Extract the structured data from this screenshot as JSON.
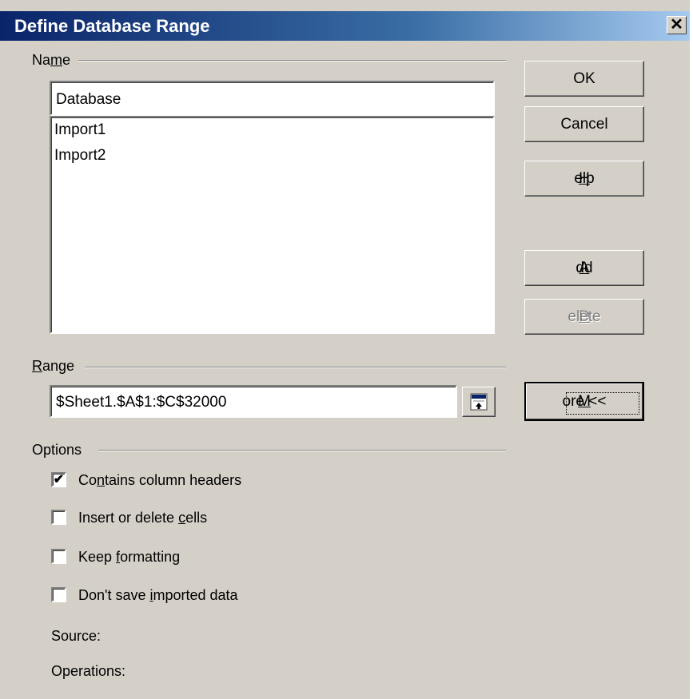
{
  "window": {
    "title": "Define Database Range",
    "close_glyph": "✕"
  },
  "name_section": {
    "label_pre": "Na",
    "label_key": "m",
    "label_post": "e",
    "input_value": "Database",
    "list_items": [
      "Import1",
      "Import2"
    ]
  },
  "range_section": {
    "label_key": "R",
    "label_post": "ange",
    "input_value": "$Sheet1.$A$1:$C$32000"
  },
  "options_section": {
    "label": "Options",
    "checkboxes": [
      {
        "pre": "Co",
        "key": "n",
        "post": "tains column headers",
        "checked": true
      },
      {
        "pre": "Insert or delete ",
        "key": "c",
        "post": "ells",
        "checked": false
      },
      {
        "pre": "Keep ",
        "key": "f",
        "post": "ormatting",
        "checked": false
      },
      {
        "pre": "Don't save ",
        "key": "i",
        "post": "mported data",
        "checked": false
      }
    ],
    "check_glyph": "✔",
    "source_label": "Source:",
    "operations_label": "Operations:"
  },
  "buttons": {
    "ok": "OK",
    "cancel": "Cancel",
    "help_key": "H",
    "help_post": "elp",
    "add_key": "A",
    "add_post": "dd",
    "delete_key": "D",
    "delete_post": "elete",
    "more_key": "M",
    "more_post": "ore <<"
  },
  "colors": {
    "dialog_bg": "#d4d0c8",
    "titlebar_start": "#0a246a",
    "titlebar_end": "#a6caf0",
    "disabled_text": "#808080"
  }
}
